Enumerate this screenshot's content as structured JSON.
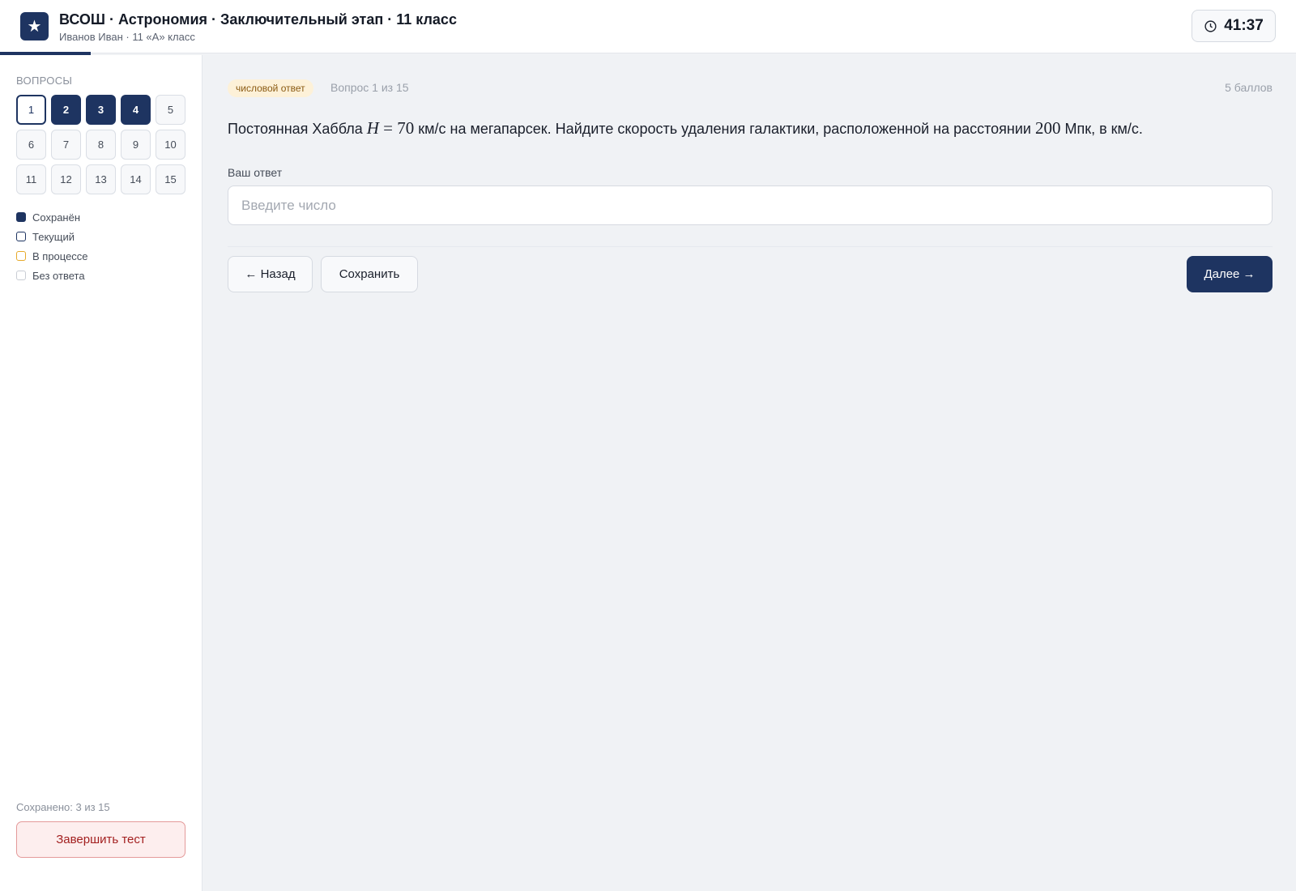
{
  "header": {
    "logo_icon": "★",
    "title": "ВСОШ · Астрономия · Заключительный этап · 11 класс",
    "subtitle": "Иванов Иван · 11 «А» класс",
    "timer": "41:37"
  },
  "sidebar": {
    "heading": "ВОПРОСЫ",
    "questions": [
      {
        "label": "1",
        "state": "current"
      },
      {
        "label": "2",
        "state": "saved"
      },
      {
        "label": "3",
        "state": "saved"
      },
      {
        "label": "4",
        "state": "saved"
      },
      {
        "label": "5",
        "state": "empty"
      },
      {
        "label": "6",
        "state": "empty"
      },
      {
        "label": "7",
        "state": "empty"
      },
      {
        "label": "8",
        "state": "empty"
      },
      {
        "label": "9",
        "state": "empty"
      },
      {
        "label": "10",
        "state": "empty"
      },
      {
        "label": "11",
        "state": "empty"
      },
      {
        "label": "12",
        "state": "empty"
      },
      {
        "label": "13",
        "state": "empty"
      },
      {
        "label": "14",
        "state": "empty"
      },
      {
        "label": "15",
        "state": "empty"
      }
    ],
    "legend": {
      "saved": "Сохранён",
      "current": "Текущий",
      "in_progress": "В процессе",
      "no_answer": "Без ответа"
    },
    "saved_count": "Сохранено: 3 из 15",
    "finish_label": "Завершить тест"
  },
  "main": {
    "type_badge": "числовой ответ",
    "question_number": "Вопрос 1 из 15",
    "points": "5 баллов",
    "question": {
      "part1": "Постоянная Хаббла ",
      "math_var": "H",
      "math_eq": " = 70",
      "part2": " км/с на мегапарсек. Найдите скорость удаления галактики, расположенной на расстоянии ",
      "math_dist": "200",
      "part3": " Мпк, в км/с."
    },
    "answer_label": "Ваш ответ",
    "answer_value": "",
    "answer_placeholder": "Введите число",
    "back_label": "← Назад",
    "save_label": "Сохранить",
    "next_label": "Далее →"
  },
  "colors": {
    "accent": "#1e3461",
    "in_progress": "#e6a92a",
    "danger": "#a32020"
  }
}
